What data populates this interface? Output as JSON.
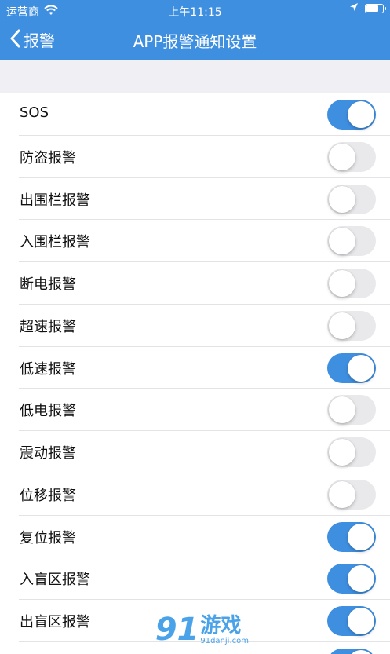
{
  "status_bar": {
    "carrier": "运营商",
    "time": "上午11:15"
  },
  "nav": {
    "back_label": "报警",
    "title": "APP报警通知设置"
  },
  "colors": {
    "accent": "#3f8fe0",
    "toggle_off": "#e9e9eb",
    "background": "#efeff4"
  },
  "settings": [
    {
      "label": "SOS",
      "enabled": true
    },
    {
      "label": "防盗报警",
      "enabled": false
    },
    {
      "label": "出围栏报警",
      "enabled": false
    },
    {
      "label": "入围栏报警",
      "enabled": false
    },
    {
      "label": "断电报警",
      "enabled": false
    },
    {
      "label": "超速报警",
      "enabled": false
    },
    {
      "label": "低速报警",
      "enabled": true
    },
    {
      "label": "低电报警",
      "enabled": false
    },
    {
      "label": "震动报警",
      "enabled": false
    },
    {
      "label": "位移报警",
      "enabled": false
    },
    {
      "label": "复位报警",
      "enabled": true
    },
    {
      "label": "入盲区报警",
      "enabled": true
    },
    {
      "label": "出盲区报警",
      "enabled": true
    },
    {
      "label": "",
      "enabled": true
    }
  ],
  "watermark": {
    "number": "91",
    "text": "游戏",
    "site": "91danji.com"
  }
}
